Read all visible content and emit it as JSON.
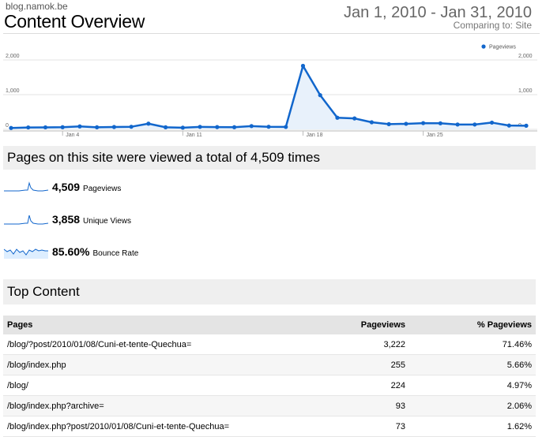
{
  "header": {
    "site": "blog.namok.be",
    "title": "Content Overview",
    "date_range": "Jan 1, 2010 - Jan 31, 2010",
    "comparing": "Comparing to: Site"
  },
  "chart": {
    "legend": "Pageviews",
    "y_ticks_left": [
      "2,000",
      "1,000",
      "0"
    ],
    "y_ticks_right": [
      "2,000",
      "1,000",
      "0"
    ],
    "x_ticks": [
      "Jan 4",
      "Jan 11",
      "Jan 18",
      "Jan 25"
    ],
    "color": "#1166cc"
  },
  "chart_data": {
    "type": "line",
    "series": [
      {
        "name": "Pageviews",
        "values": [
          40,
          55,
          58,
          62,
          85,
          60,
          68,
          75,
          165,
          60,
          48,
          72,
          65,
          62,
          95,
          75,
          70,
          1830,
          985,
          335,
          315,
          205,
          150,
          160,
          180,
          175,
          140,
          140,
          195,
          110,
          105
        ]
      }
    ],
    "x": [
      "Jan 1",
      "Jan 2",
      "Jan 3",
      "Jan 4",
      "Jan 5",
      "Jan 6",
      "Jan 7",
      "Jan 8",
      "Jan 9",
      "Jan 10",
      "Jan 11",
      "Jan 12",
      "Jan 13",
      "Jan 14",
      "Jan 15",
      "Jan 16",
      "Jan 17",
      "Jan 18",
      "Jan 19",
      "Jan 20",
      "Jan 21",
      "Jan 22",
      "Jan 23",
      "Jan 24",
      "Jan 25",
      "Jan 26",
      "Jan 27",
      "Jan 28",
      "Jan 29",
      "Jan 30",
      "Jan 31"
    ],
    "ylim": [
      0,
      2000
    ],
    "xlabel": "",
    "ylabel": "",
    "grid": true,
    "legend": "top-right"
  },
  "summary": {
    "total_text": "Pages on this site were viewed a total of 4,509 times",
    "metrics": [
      {
        "value": "4,509",
        "label": "Pageviews"
      },
      {
        "value": "3,858",
        "label": "Unique Views"
      },
      {
        "value": "85.60%",
        "label": "Bounce Rate"
      }
    ]
  },
  "top_content": {
    "title": "Top Content",
    "columns": [
      "Pages",
      "Pageviews",
      "% Pageviews"
    ],
    "rows": [
      {
        "page": "/blog/?post/2010/01/08/Cuni-et-tente-Quechua=",
        "views": "3,222",
        "pct": "71.46%"
      },
      {
        "page": "/blog/index.php",
        "views": "255",
        "pct": "5.66%"
      },
      {
        "page": "/blog/",
        "views": "224",
        "pct": "4.97%"
      },
      {
        "page": "/blog/index.php?archive=",
        "views": "93",
        "pct": "2.06%"
      },
      {
        "page": "/blog/index.php?post/2010/01/08/Cuni-et-tente-Quechua=",
        "views": "73",
        "pct": "1.62%"
      }
    ]
  }
}
